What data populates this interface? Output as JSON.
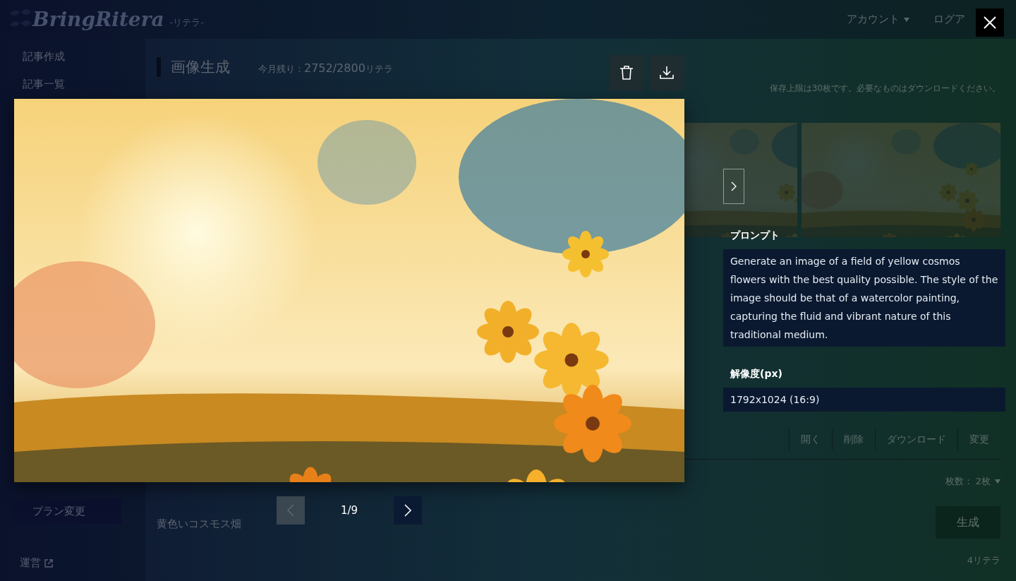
{
  "header": {
    "logo": "BringRitera",
    "logo_sub": "-リテラ-",
    "menu": [
      {
        "label": "アカウント",
        "dropdown": true
      },
      {
        "label": "ログア",
        "dropdown": false
      }
    ]
  },
  "sidebar": {
    "items": [
      {
        "label": "記事作成"
      },
      {
        "label": "記事一覧"
      }
    ],
    "plan_button": "プラン変更",
    "footer_link": "運営"
  },
  "main": {
    "title": "画像生成",
    "quota_label": "今月残り：",
    "quota_value": "2752/2800",
    "quota_unit": "リテラ",
    "notice": "保存上限は30枚です。必要なものはダウンロードください。",
    "toolbar": [
      "開く",
      "削除",
      "ダウンロード",
      "変更"
    ],
    "caption": "黄色いコスモス畑",
    "count_label": "枚数：",
    "count_value": "2枚",
    "generate_button": "生成",
    "cost": "4リテラ"
  },
  "viewer": {
    "prompt": {
      "label": "プロンプト",
      "text": "Generate an image of a field of yellow cosmos flowers with the best quality possible. The style of the image should be that of a watercolor painting, capturing the fluid and vibrant nature of this traditional medium."
    },
    "resolution": {
      "label": "解像度(px)",
      "value": "1792x1024 (16:9)"
    },
    "pager": {
      "current": "1/9",
      "prev_disabled": true,
      "next_disabled": false
    }
  }
}
